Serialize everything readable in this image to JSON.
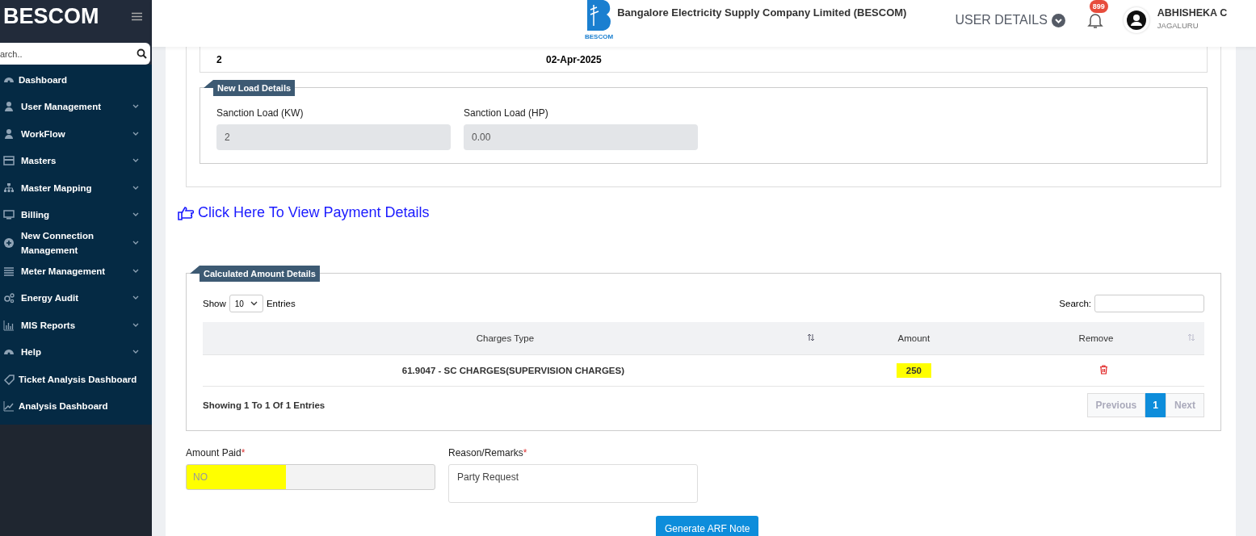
{
  "sidebar": {
    "brand": "BESCOM",
    "search": {
      "placeholder": "arch.."
    },
    "items": [
      {
        "label": "Dashboard",
        "expandable": false
      },
      {
        "label": "User Management",
        "expandable": true
      },
      {
        "label": "WorkFlow",
        "expandable": true
      },
      {
        "label": "Masters",
        "expandable": true
      },
      {
        "label": "Master Mapping",
        "expandable": true
      },
      {
        "label": "Billing",
        "expandable": true
      },
      {
        "label": "New Connection Management",
        "expandable": true
      },
      {
        "label": "Meter Management",
        "expandable": true
      },
      {
        "label": "Energy Audit",
        "expandable": true
      },
      {
        "label": "MIS Reports",
        "expandable": true
      },
      {
        "label": "Help",
        "expandable": true
      },
      {
        "label": "Ticket Analysis Dashboard",
        "expandable": false
      },
      {
        "label": "Analysis Dashboard",
        "expandable": false
      }
    ]
  },
  "header": {
    "logo_caption": "BESCOM",
    "company": "Bangalore Electricity Supply Company Limited (BESCOM)",
    "user_details": "USER DETAILS",
    "notifications": "899",
    "user_name": "ABHISHEKA C",
    "user_location": "JAGALURU"
  },
  "top_card": {
    "values": [
      "2",
      "02-Apr-2025"
    ]
  },
  "new_load": {
    "title": "New Load Details",
    "fields": [
      {
        "label": "Sanction Load (KW)",
        "value": "2"
      },
      {
        "label": "Sanction Load (HP)",
        "value": "0.00"
      }
    ]
  },
  "payment_link": "Click Here To View Payment Details",
  "calculated": {
    "title": "Calculated Amount Details",
    "show_label": "Show",
    "page_size": "10",
    "entries_label": "Entries",
    "search_label": "Search:",
    "columns": [
      "Charges Type",
      "Amount",
      "Remove"
    ],
    "rows": [
      {
        "charges_type": "61.9047 - SC CHARGES(SUPERVISION CHARGES)",
        "amount": "250",
        "amount_highlighted": true
      }
    ],
    "info": "Showing 1 To 1 Of 1 Entries",
    "pagination": [
      {
        "label": "Previous",
        "kind": "nav",
        "selected": false
      },
      {
        "label": "1",
        "kind": "page",
        "selected": true
      },
      {
        "label": "Next",
        "kind": "nav",
        "selected": false
      }
    ]
  },
  "form": {
    "fields": [
      {
        "label": "Amount Paid",
        "required": "*",
        "value": "NO",
        "kind": "select",
        "highlighted": true
      },
      {
        "label": "Reason/Remarks",
        "required": "*",
        "value": "Party Request",
        "kind": "textarea",
        "highlighted": false
      }
    ],
    "submit": "Generate ARF Note"
  }
}
